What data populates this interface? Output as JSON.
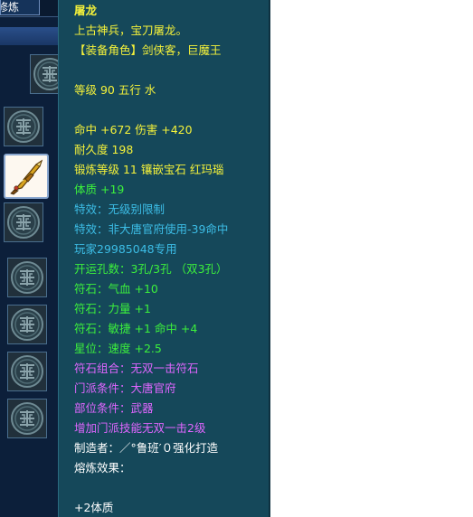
{
  "inventory": {
    "tab_label": "修炼",
    "slots": [
      {
        "icon": "seal-pattern-icon"
      },
      {
        "icon": "seal-pattern-icon"
      },
      {
        "icon": "dragon-blade-icon",
        "selected": true
      },
      {
        "icon": "seal-pattern-icon"
      },
      {
        "icon": "seal-pattern-icon"
      },
      {
        "icon": "seal-pattern-icon"
      },
      {
        "icon": "seal-pattern-icon"
      },
      {
        "icon": "seal-pattern-icon"
      }
    ]
  },
  "tooltip": {
    "name": "屠龙",
    "description": "上古神兵，宝刀屠龙。",
    "equip_roles": "【装备角色】剑侠客，巨魔王",
    "level_element": "等级 90 五行 水",
    "hit_damage": "命中 +672 伤害 +420",
    "durability": "耐久度 198",
    "forge": "锻炼等级 11 镶嵌宝石 红玛瑙",
    "constitution": "体质 +19",
    "special_1": "特效：无级别限制",
    "special_2": "特效：非大唐官府使用-39命中",
    "owner": "玩家29985048专用",
    "holes": "开运孔数：3孔/3孔 （双3孔）",
    "rune_1": "符石：气血 +10",
    "rune_2": "符石：力量 +1",
    "rune_3": "符石：敏捷 +1 命中 +4",
    "star": "星位：速度 +2.5",
    "rune_combo": "符石组合：无双一击符石",
    "sect_req": "门派条件：大唐官府",
    "slot_req": "部位条件：武器",
    "skill_bonus": "增加门派技能无双一击2级",
    "maker": "制造者：／°鲁班′０强化打造",
    "smelt_title": "熔炼效果：",
    "smelt_value": "+2体质"
  },
  "colors": {
    "tooltip_bg": "#15485a",
    "yellow": "#f5f23a",
    "green": "#3cf03c",
    "cyan": "#3cbde6",
    "purple": "#e066ff",
    "white": "#ffffff"
  }
}
